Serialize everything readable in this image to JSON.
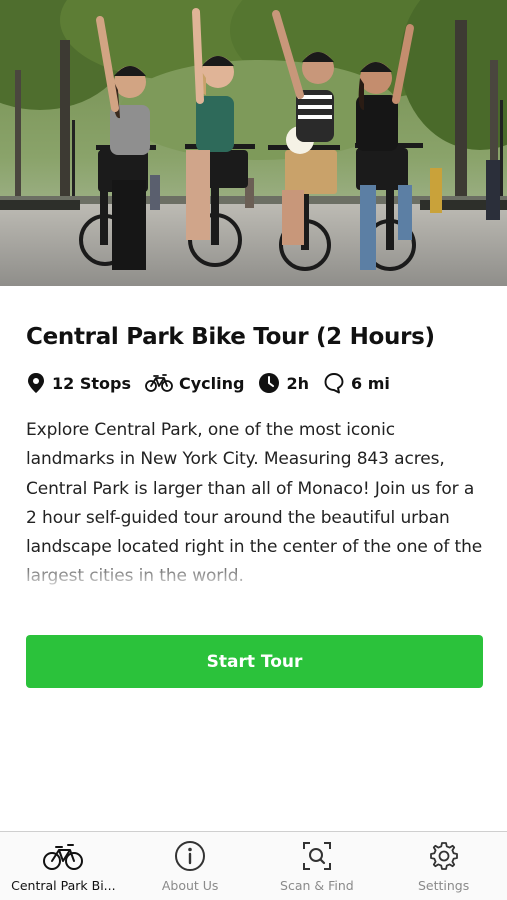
{
  "hero": {
    "image_label": "Four women on bicycles raising arms in Central Park"
  },
  "tour": {
    "title": "Central Park Bike Tour (2 Hours)",
    "meta": {
      "stops": "12 Stops",
      "mode": "Cycling",
      "duration": "2h",
      "distance": "6 mi"
    },
    "description": "Explore Central Park, one of the most iconic landmarks in New York City. Measuring 843 acres, Central Park is larger than all of Monaco! Join us for a 2 hour self-guided tour around the beautiful urban landscape located right in the center of the one of the largest cities in the world."
  },
  "actions": {
    "start_label": "Start Tour"
  },
  "tabs": [
    {
      "label": "Central Park Bi...",
      "icon": "bicycle-icon",
      "active": true
    },
    {
      "label": "About Us",
      "icon": "info-icon",
      "active": false
    },
    {
      "label": "Scan & Find",
      "icon": "scan-icon",
      "active": false
    },
    {
      "label": "Settings",
      "icon": "gear-icon",
      "active": false
    }
  ],
  "colors": {
    "accent": "#2bc23b",
    "tab_active": "#111111",
    "tab_inactive": "#8a8a8a"
  }
}
